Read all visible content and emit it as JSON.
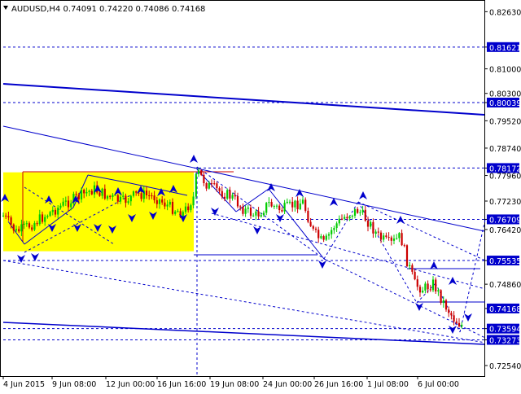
{
  "header": {
    "symbol_line": "AUDUSD,H4  0.74091 0.74220 0.74086 0.74168"
  },
  "colors": {
    "background": "#ffffff",
    "axis_text": "#000000",
    "line_blue": "#0000cc",
    "bull_candle": "#00cc00",
    "bear_candle": "#cc0000",
    "zone_fill": "#ffff00",
    "zone_border": "#cc0000",
    "price_box": "#0000cc",
    "price_box_text": "#ffffff"
  },
  "price_axis": {
    "ticks": [
      "0.82630",
      "0.81621",
      "0.81000",
      "0.80300",
      "0.80039",
      "0.79520",
      "0.78740",
      "0.78172",
      "0.77960",
      "0.77230",
      "0.76709",
      "0.76420",
      "0.75535",
      "0.74860",
      "0.74168",
      "0.73594",
      "0.73273",
      "0.72540"
    ],
    "highlighted": [
      "0.81621",
      "0.80039",
      "0.78172",
      "0.76709",
      "0.75535",
      "0.74168",
      "0.73594",
      "0.73273"
    ]
  },
  "time_axis": {
    "labels": [
      "4 Jun 2015",
      "9 Jun 08:00",
      "12 Jun 00:00",
      "16 Jun 16:00",
      "19 Jun 08:00",
      "24 Jun 00:00",
      "26 Jun 16:00",
      "1 Jul 08:00",
      "6 Jul 00:00"
    ]
  },
  "chart_data": {
    "type": "candlestick",
    "instrument": "AUDUSD",
    "timeframe": "H4",
    "last_bar": {
      "open": 0.74091,
      "high": 0.7422,
      "low": 0.74086,
      "close": 0.74168
    },
    "price_range": [
      0.7224,
      0.8294
    ],
    "horizontal_levels": [
      0.81621,
      0.80039,
      0.78172,
      0.76709,
      0.75535,
      0.73594,
      0.73273
    ],
    "consolidation_zone": {
      "from": "3 Jun 2015",
      "to": "18 Jun 2015",
      "high": 0.7805,
      "low": 0.758
    },
    "grid": false
  }
}
